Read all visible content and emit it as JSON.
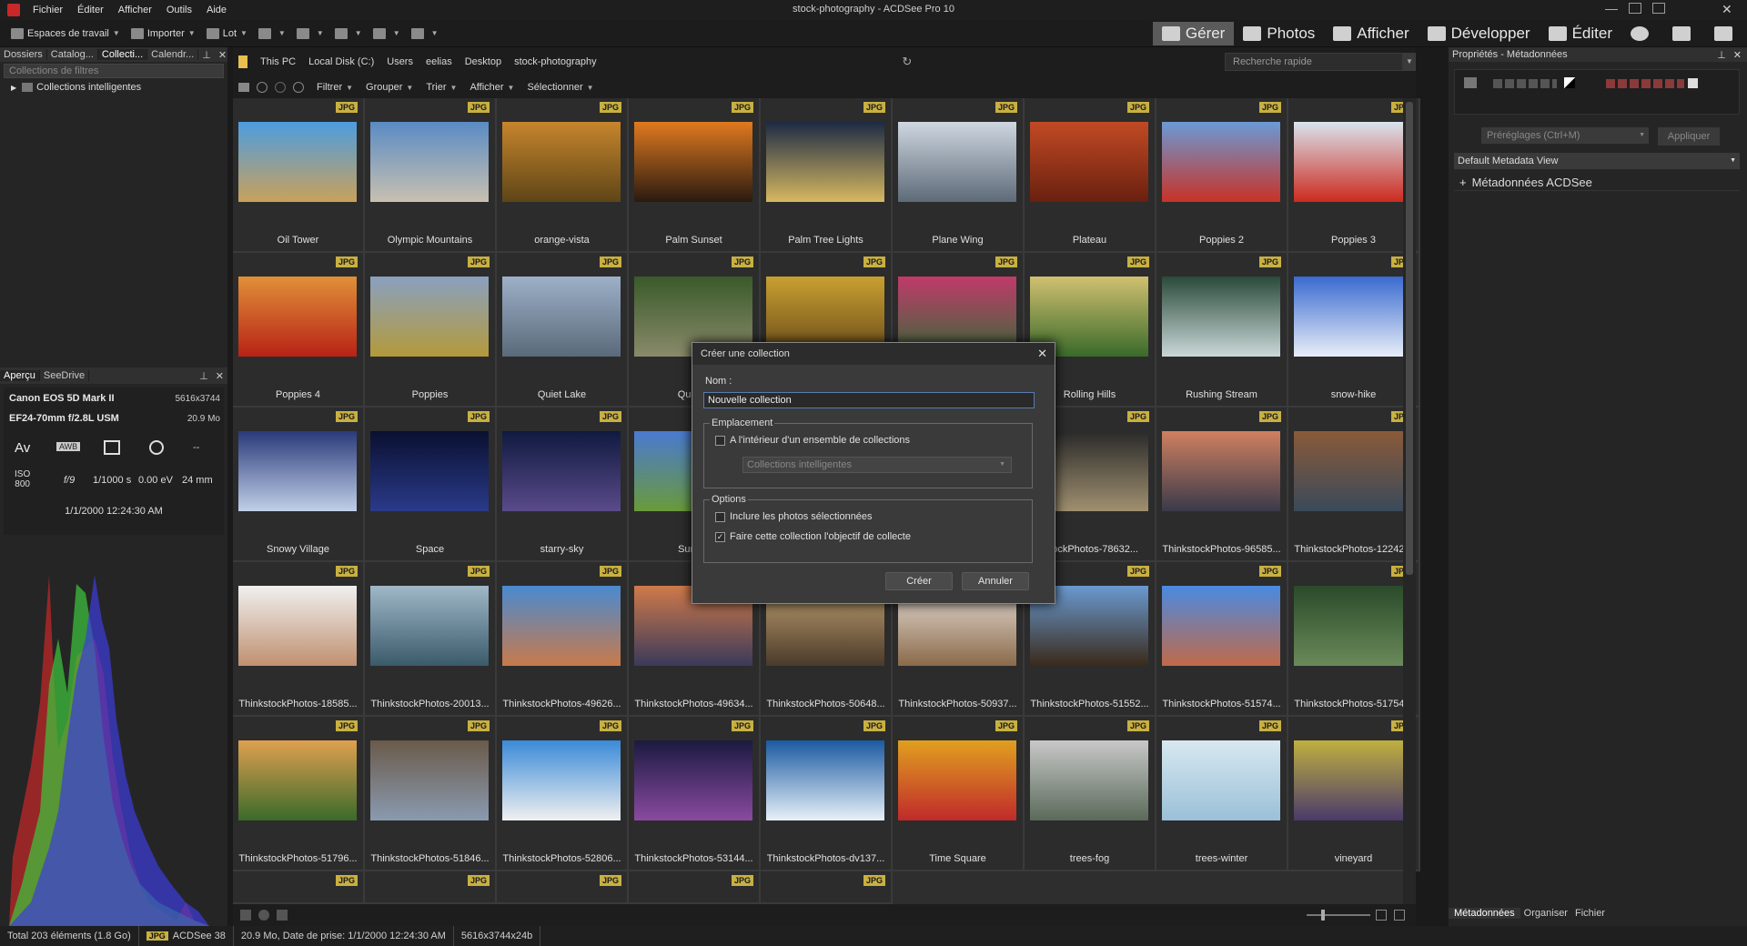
{
  "app": {
    "title": "stock-photography - ACDSee Pro 10",
    "menu": [
      "Fichier",
      "Éditer",
      "Afficher",
      "Outils",
      "Aide"
    ]
  },
  "toolbar": {
    "items": [
      "Espaces de travail",
      "Importer",
      "Lot"
    ],
    "modes": [
      {
        "label": "Gérer",
        "icon": "grid-icon",
        "active": true
      },
      {
        "label": "Photos",
        "icon": "photos-icon"
      },
      {
        "label": "Afficher",
        "icon": "eye-icon"
      },
      {
        "label": "Développer",
        "icon": "develop-icon"
      },
      {
        "label": "Éditer",
        "icon": "edit-icon"
      }
    ]
  },
  "left": {
    "tabs": [
      "Dossiers",
      "Catalog...",
      "Collecti...",
      "Calendr..."
    ],
    "filter_placeholder": "Collections de filtres",
    "tree_item": "Collections intelligentes",
    "preview_tabs": [
      "Aperçu",
      "SeeDrive"
    ],
    "camera": "Canon EOS 5D Mark II",
    "dims": "5616x3744",
    "lens": "EF24-70mm f/2.8L USM",
    "size": "20.9 Mo",
    "icons": [
      "Av",
      "AWB",
      "",
      ""
    ],
    "iso_label": "ISO",
    "iso": "800",
    "aperture": "f/9",
    "shutter": "1/1000 s",
    "ev": "0.00 eV",
    "focal": "24 mm",
    "datetime": "1/1/2000 12:24:30 AM"
  },
  "address": {
    "crumbs": [
      "This PC",
      "Local Disk (C:)",
      "Users",
      "eelias",
      "Desktop",
      "stock-photography"
    ],
    "search_placeholder": "Recherche rapide"
  },
  "filterbar": [
    "Filtrer",
    "Grouper",
    "Trier",
    "Afficher",
    "Sélectionner"
  ],
  "badge": "JPG",
  "thumbs": [
    {
      "name": "Oil Tower",
      "c1": "#4d9de0",
      "c2": "#c9a15a"
    },
    {
      "name": "Olympic Mountains",
      "c1": "#5a8bc4",
      "c2": "#c8c0b0"
    },
    {
      "name": "orange-vista",
      "c1": "#c7852c",
      "c2": "#5e4517"
    },
    {
      "name": "Palm Sunset",
      "c1": "#e07a1f",
      "c2": "#2a1a10"
    },
    {
      "name": "Palm Tree Lights",
      "c1": "#1c2a44",
      "c2": "#d6b860"
    },
    {
      "name": "Plane Wing",
      "c1": "#cfd7e0",
      "c2": "#5d6a78"
    },
    {
      "name": "Plateau",
      "c1": "#c24a24",
      "c2": "#6a2010"
    },
    {
      "name": "Poppies 2",
      "c1": "#6a9ad6",
      "c2": "#c83226"
    },
    {
      "name": "Poppies 3",
      "c1": "#d9e4ee",
      "c2": "#cc2a1e"
    },
    {
      "name": "Poppies 4",
      "c1": "#e09038",
      "c2": "#b82216"
    },
    {
      "name": "Poppies",
      "c1": "#8aa0c0",
      "c2": "#b39a3a"
    },
    {
      "name": "Quiet Lake",
      "c1": "#9db0c8",
      "c2": "#5a6a7a"
    },
    {
      "name": "Quiet...",
      "c1": "#3a5a2a",
      "c2": "#8a8a6a"
    },
    {
      "name": "",
      "c1": "#c8a030",
      "c2": "#6a4a1a"
    },
    {
      "name": "",
      "c1": "#c03a6a",
      "c2": "#3a6a3a"
    },
    {
      "name": "Rolling Hills",
      "c1": "#d0c070",
      "c2": "#3a6a2a"
    },
    {
      "name": "Rushing Stream",
      "c1": "#2a4a3a",
      "c2": "#cad8d8"
    },
    {
      "name": "snow-hike",
      "c1": "#3a6ad0",
      "c2": "#e8eef8"
    },
    {
      "name": "Snowy Village",
      "c1": "#2a3a7a",
      "c2": "#c0d0e8"
    },
    {
      "name": "Space",
      "c1": "#0a1030",
      "c2": "#2a3a8a"
    },
    {
      "name": "starry-sky",
      "c1": "#101a40",
      "c2": "#5a4a8a"
    },
    {
      "name": "Sunn...",
      "c1": "#4a7ad0",
      "c2": "#6a9a3a"
    },
    {
      "name": "",
      "c1": "#333",
      "c2": "#333"
    },
    {
      "name": "",
      "c1": "#333",
      "c2": "#333"
    },
    {
      "name": "...tockPhotos-78632...",
      "c1": "#2a2a2a",
      "c2": "#a09070"
    },
    {
      "name": "ThinkstockPhotos-96585...",
      "c1": "#d08060",
      "c2": "#3a3a4a"
    },
    {
      "name": "ThinkstockPhotos-12242...",
      "c1": "#8a5a3a",
      "c2": "#3a4a5a"
    },
    {
      "name": "ThinkstockPhotos-18585...",
      "c1": "#f0f0f0",
      "c2": "#c09070"
    },
    {
      "name": "ThinkstockPhotos-20013...",
      "c1": "#a0b8c8",
      "c2": "#3a5a6a"
    },
    {
      "name": "ThinkstockPhotos-49626...",
      "c1": "#4a8ad0",
      "c2": "#c87a4a"
    },
    {
      "name": "ThinkstockPhotos-49634...",
      "c1": "#d07a4a",
      "c2": "#3a3a5a"
    },
    {
      "name": "ThinkstockPhotos-50648...",
      "c1": "#c0a070",
      "c2": "#4a3a2a"
    },
    {
      "name": "ThinkstockPhotos-50937...",
      "c1": "#e8e0d8",
      "c2": "#8a6a4a"
    },
    {
      "name": "ThinkstockPhotos-51552...",
      "c1": "#6a9ad0",
      "c2": "#3a2a1a"
    },
    {
      "name": "ThinkstockPhotos-51574...",
      "c1": "#4a8ae0",
      "c2": "#c06a4a"
    },
    {
      "name": "ThinkstockPhotos-51754...",
      "c1": "#2a4a2a",
      "c2": "#6a8a5a"
    },
    {
      "name": "ThinkstockPhotos-51796...",
      "c1": "#e0a050",
      "c2": "#3a6a2a"
    },
    {
      "name": "ThinkstockPhotos-51846...",
      "c1": "#6a5a4a",
      "c2": "#8a9ab0"
    },
    {
      "name": "ThinkstockPhotos-52806...",
      "c1": "#3a8ad8",
      "c2": "#f0f0f0"
    },
    {
      "name": "ThinkstockPhotos-53144...",
      "c1": "#1a1a40",
      "c2": "#8a4aa0"
    },
    {
      "name": "ThinkstockPhotos-dv137...",
      "c1": "#1a5aa0",
      "c2": "#e8f0f8"
    },
    {
      "name": "Time Square",
      "c1": "#e0a020",
      "c2": "#c02a2a"
    },
    {
      "name": "trees-fog",
      "c1": "#c8c8c8",
      "c2": "#5a6a5a"
    },
    {
      "name": "trees-winter",
      "c1": "#d8e8f0",
      "c2": "#9ac0d8"
    },
    {
      "name": "vineyard",
      "c1": "#c0b040",
      "c2": "#4a3a6a"
    }
  ],
  "dialog": {
    "title": "Créer une collection",
    "name_label": "Nom :",
    "name_value": "Nouvelle collection",
    "group1": "Emplacement",
    "chk1": "A l'intérieur d'un ensemble de collections",
    "select": "Collections intelligentes",
    "group2": "Options",
    "chk2": "Inclure les photos sélectionnées",
    "chk3": "Faire cette collection l'objectif de collecte",
    "create": "Créer",
    "cancel": "Annuler"
  },
  "right": {
    "title": "Propriétés - Métadonnées",
    "presets": "Préréglages (Ctrl+M)",
    "apply": "Appliquer",
    "view": "Default Metadata View",
    "section": "Métadonnées ACDSee",
    "tabs": [
      "Métadonnées",
      "Organiser",
      "Fichier"
    ]
  },
  "status": {
    "total": "Total 203 éléments  (1.8 Go)",
    "badge": "JPG",
    "file": "ACDSee 38",
    "info": "20.9 Mo, Date de prise: 1/1/2000 12:24:30 AM",
    "dims": "5616x3744x24b"
  }
}
